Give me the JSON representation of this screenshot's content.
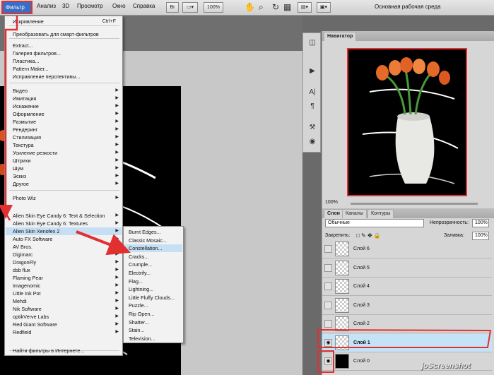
{
  "menubar": {
    "filter": "Фильтр",
    "analysis": "Анализ",
    "three_d": "3D",
    "view": "Просмотр",
    "window": "Окно",
    "help": "Справка",
    "bridge_icon": "Br",
    "zoom": "100%",
    "workspace": "Основная рабочая среда"
  },
  "filter_menu": {
    "items": [
      {
        "label": "Искривление",
        "shortcut": "Ctrl+F"
      },
      {
        "label": "Преобразовать для смарт-фильтров"
      },
      {
        "label": "Extract..."
      },
      {
        "label": "Галерея фильтров..."
      },
      {
        "label": "Пластика..."
      },
      {
        "label": "Pattern Maker..."
      },
      {
        "label": "Исправление перспективы..."
      },
      {
        "label": "Видео",
        "sub": true
      },
      {
        "label": "Имитация",
        "sub": true
      },
      {
        "label": "Искажение",
        "sub": true
      },
      {
        "label": "Оформление",
        "sub": true
      },
      {
        "label": "Размытие",
        "sub": true
      },
      {
        "label": "Рендеринг",
        "sub": true
      },
      {
        "label": "Стилизация",
        "sub": true
      },
      {
        "label": "Текстура",
        "sub": true
      },
      {
        "label": "Усиление резкости",
        "sub": true
      },
      {
        "label": "Штрихи",
        "sub": true
      },
      {
        "label": "Шум",
        "sub": true
      },
      {
        "label": "Эскиз",
        "sub": true
      },
      {
        "label": "Другое",
        "sub": true
      },
      {
        "label": "Photo Wiz",
        "sub": true
      },
      {
        "label": "Alien Skin Eye Candy 6: Text & Selection",
        "sub": true
      },
      {
        "label": "Alien Skin Eye Candy 6: Textures",
        "sub": true
      },
      {
        "label": "Alien Skin Xenofex 2",
        "sub": true
      },
      {
        "label": "Auto FX Software",
        "sub": true
      },
      {
        "label": "AV Bros.",
        "sub": true
      },
      {
        "label": "Digimarc",
        "sub": true
      },
      {
        "label": "DragonFly",
        "sub": true
      },
      {
        "label": "dsb flux",
        "sub": true
      },
      {
        "label": "Flaming Pear",
        "sub": true
      },
      {
        "label": "Imagenomic",
        "sub": true
      },
      {
        "label": "Little Ink Pot",
        "sub": true
      },
      {
        "label": "Mehdi",
        "sub": true
      },
      {
        "label": "Nik Software",
        "sub": true
      },
      {
        "label": "optikVerve Labs",
        "sub": true
      },
      {
        "label": "Red Giant Software",
        "sub": true
      },
      {
        "label": "Redfield",
        "sub": true
      },
      {
        "label": "Найти фильтры в Интернете..."
      }
    ]
  },
  "sub_menu": {
    "items": [
      "Burnt Edges...",
      "Classic Mosaic...",
      "Constellation...",
      "Cracks...",
      "Crumple...",
      "Electrify...",
      "Flag...",
      "Lightning...",
      "Little Fluffy Clouds...",
      "Puzzle...",
      "Rip Open...",
      "Shatter...",
      "Stain...",
      "Television..."
    ]
  },
  "navigator": {
    "tab": "Навигатор",
    "zoom": "100%"
  },
  "layers_panel": {
    "tabs": [
      "Слои",
      "Каналы",
      "Контуры"
    ],
    "blend_mode": "Обычные",
    "opacity_label": "Непрозрачность:",
    "opacity_value": "100%",
    "lock_label": "Закрепить:",
    "fill_label": "Заливка:",
    "fill_value": "100%",
    "layers": [
      {
        "name": "Слой 6",
        "visible": false,
        "selected": false
      },
      {
        "name": "Слой 5",
        "visible": false,
        "selected": false
      },
      {
        "name": "Слой 4",
        "visible": false,
        "selected": false
      },
      {
        "name": "Слой 3",
        "visible": false,
        "selected": false
      },
      {
        "name": "Слой 2",
        "visible": false,
        "selected": false
      },
      {
        "name": "Слой 1",
        "visible": true,
        "selected": true
      },
      {
        "name": "Слой 0",
        "visible": true,
        "selected": false
      }
    ]
  },
  "watermark": "joScreenshot",
  "colors": {
    "highlight": "#c6dff5",
    "selected_layer": "#c5e3f7",
    "annotation_red": "#e03030",
    "menu_active": "#3a6ec4"
  }
}
